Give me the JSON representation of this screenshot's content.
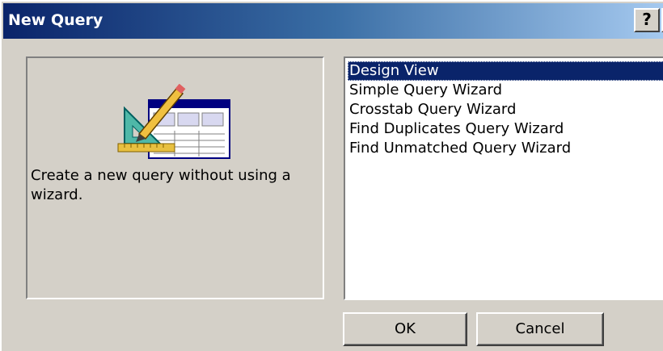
{
  "window": {
    "title": "New Query",
    "help_label": "?",
    "close_label": "×"
  },
  "preview": {
    "icon": "query-design-icon",
    "description": "Create a new query without using a wizard."
  },
  "list": {
    "selected_index": 0,
    "items": [
      {
        "label": "Design View"
      },
      {
        "label": "Simple Query Wizard"
      },
      {
        "label": "Crosstab Query Wizard"
      },
      {
        "label": "Find Duplicates Query Wizard"
      },
      {
        "label": "Find Unmatched Query Wizard"
      }
    ]
  },
  "buttons": {
    "ok_label": "OK",
    "cancel_label": "Cancel"
  },
  "colors": {
    "title_start": "#0a246a",
    "title_end": "#a6caf0",
    "face": "#d4d0c8",
    "selection": "#0a246a"
  }
}
